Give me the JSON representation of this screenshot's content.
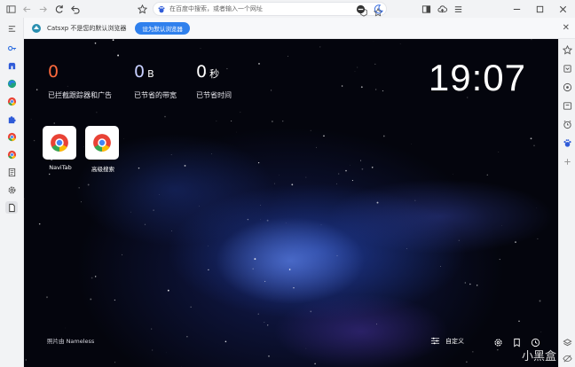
{
  "toolbar": {
    "address_placeholder": "在百度中搜索，或者输入一个网址"
  },
  "infobar": {
    "message": "Catsxp 不是您的默认浏览器",
    "set_default_label": "设为默认浏览器",
    "close_label": "✕"
  },
  "newtab": {
    "stats": [
      {
        "value": "0",
        "unit": "",
        "label": "已拦截跟踪器和广告",
        "color": "#ff6a3d"
      },
      {
        "value": "0",
        "unit": "B",
        "label": "已节省的带宽",
        "color": "#c7cfff"
      },
      {
        "value": "0",
        "unit": "秒",
        "label": "已节省时间",
        "color": "#ffffff"
      }
    ],
    "clock": "19:07",
    "shortcuts": [
      {
        "label": "NaviTab"
      },
      {
        "label": "高级搜索"
      }
    ],
    "credit": "照片由 Nameless",
    "customize_label": "自定义",
    "watermark": "小黑盒"
  },
  "colors": {
    "accent": "#2f80ed",
    "blocked": "#ff6a3d"
  }
}
